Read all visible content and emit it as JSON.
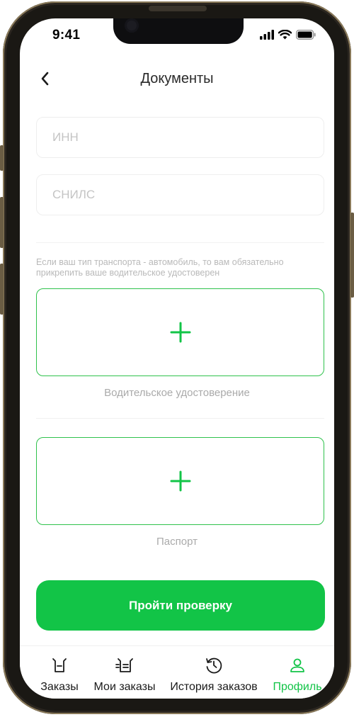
{
  "status_bar": {
    "time": "9:41"
  },
  "header": {
    "title": "Документы"
  },
  "form": {
    "inn": {
      "placeholder": "ИНН",
      "value": ""
    },
    "snils": {
      "placeholder": "СНИЛС",
      "value": ""
    },
    "hint": "Если ваш тип транспорта - автомобиль, то вам обязательно прикрепить ваше водительское удостоверен"
  },
  "uploads": [
    {
      "label": "Водительское удостоверение",
      "icon": "plus-icon"
    },
    {
      "label": "Паспорт",
      "icon": "plus-icon"
    }
  ],
  "submit_label": "Пройти проверку",
  "tabbar": {
    "tabs": [
      {
        "label": "Заказы",
        "icon": "orders-icon",
        "active": false
      },
      {
        "label": "Мои заказы",
        "icon": "my-orders-icon",
        "active": false
      },
      {
        "label": "История заказов",
        "icon": "history-icon",
        "active": false
      },
      {
        "label": "Профиль",
        "icon": "profile-icon",
        "active": true
      }
    ]
  },
  "colors": {
    "accent": "#12c447",
    "upload_border": "#2fc24c",
    "tab_inactive": "#1a1a1a",
    "tab_active": "#12c447"
  }
}
